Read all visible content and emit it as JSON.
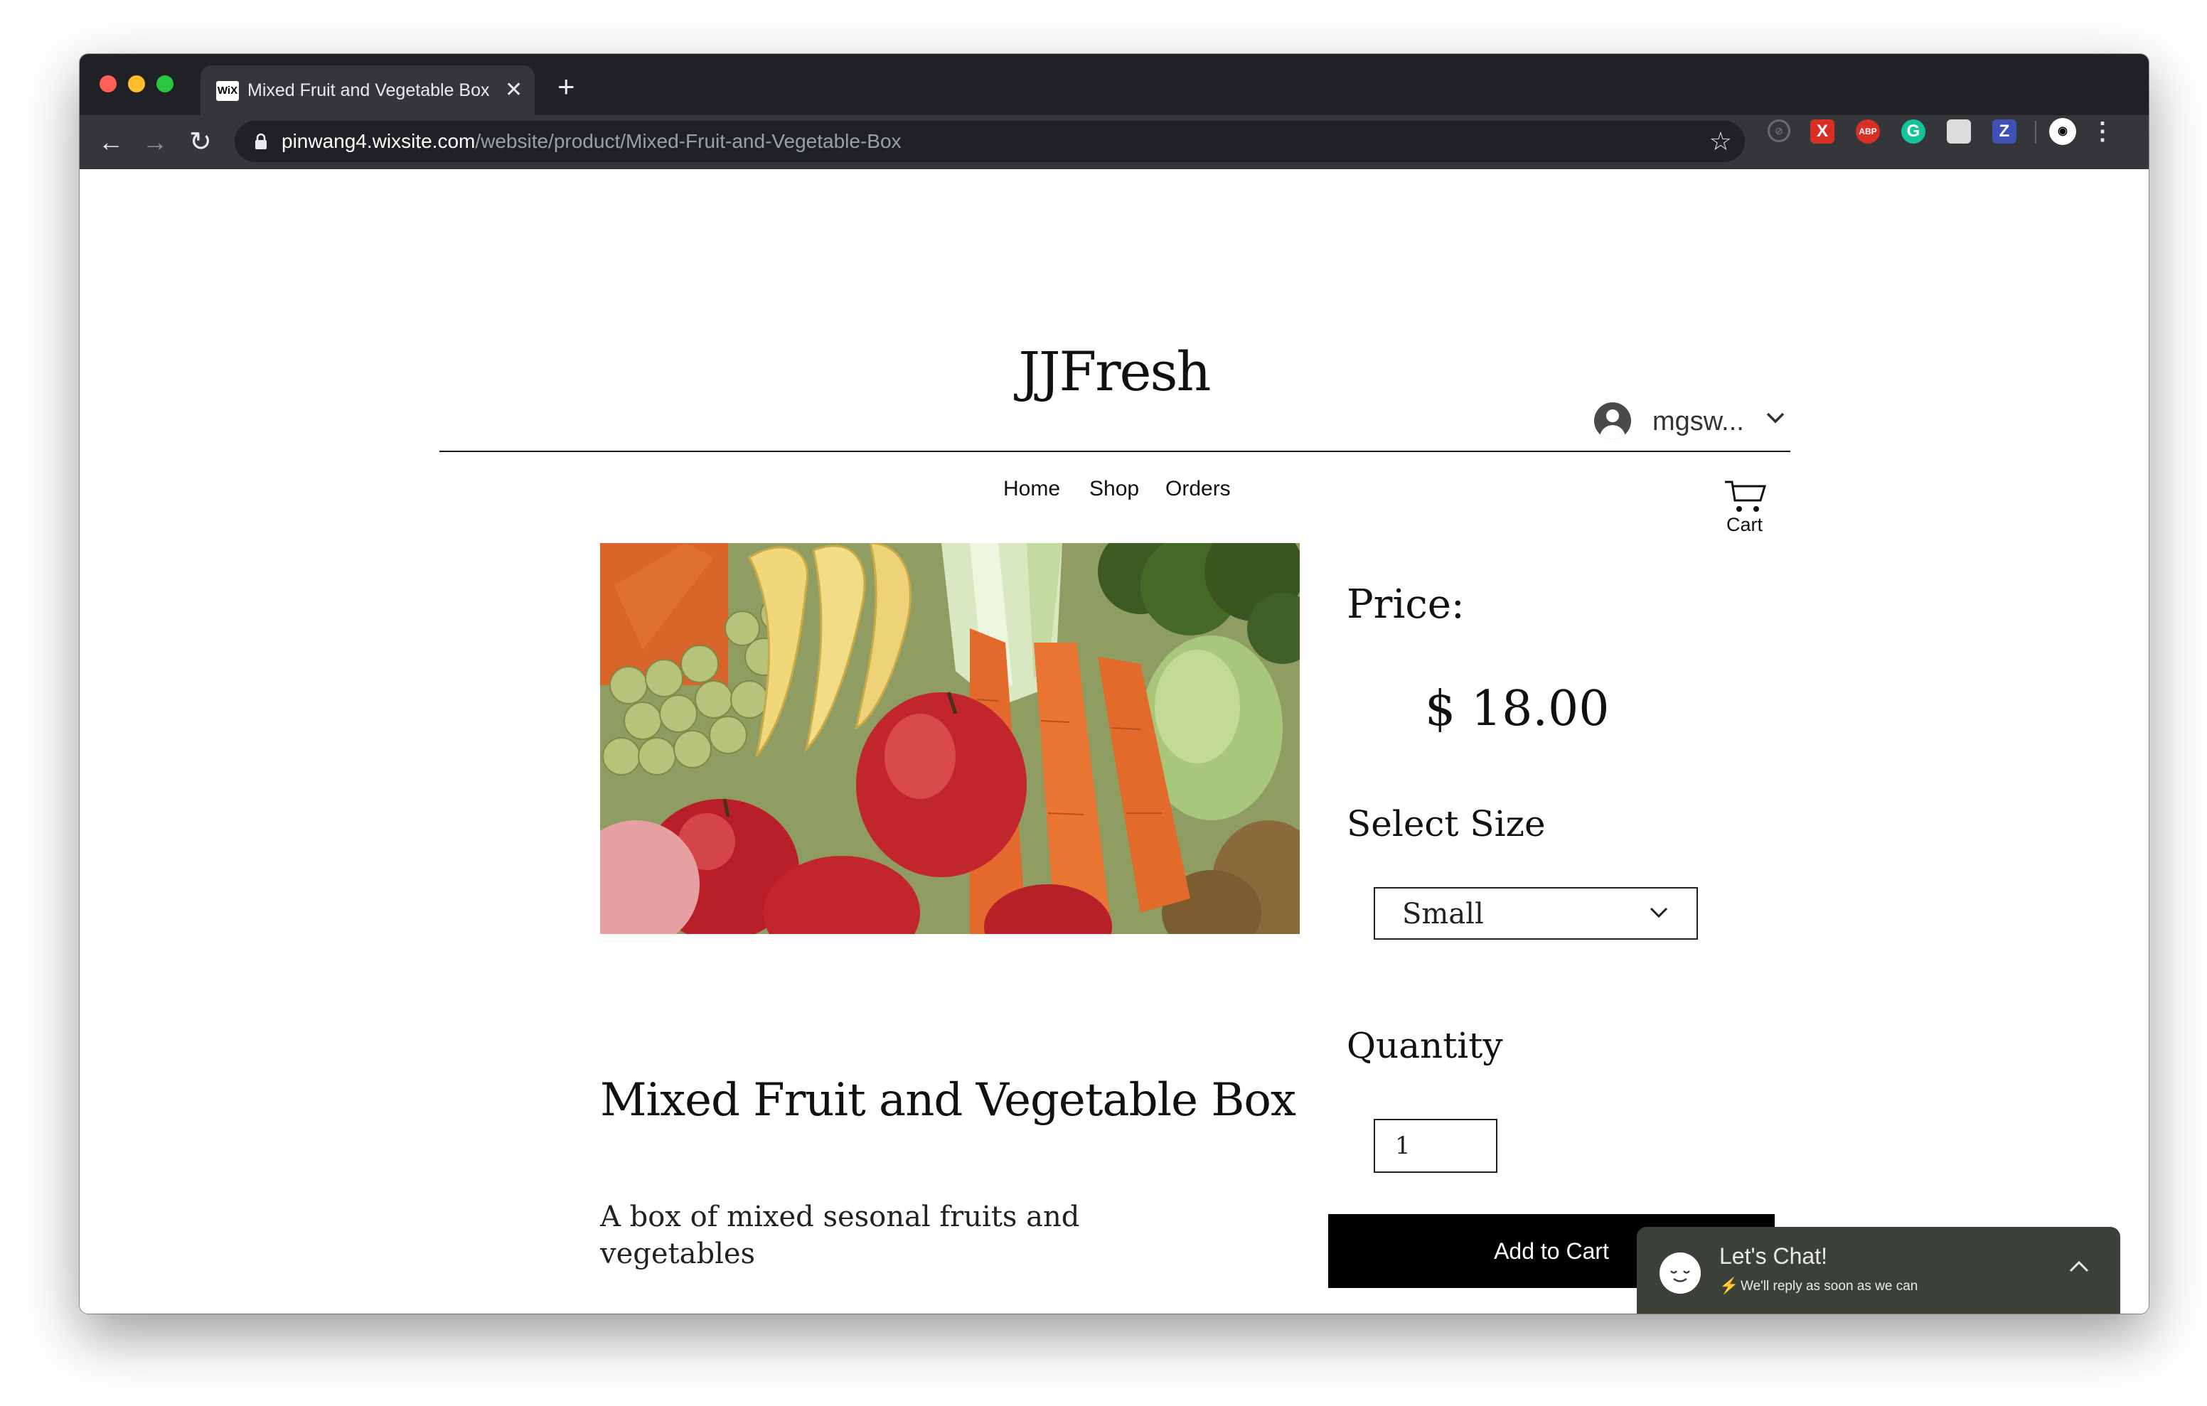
{
  "browser": {
    "tab_title": "Mixed Fruit and Vegetable Box",
    "favicon_text": "WiX",
    "url_host": "pinwang4.wixsite.com",
    "url_path": "/website/product/Mixed-Fruit-and-Vegetable-Box",
    "extensions": [
      "sync-icon",
      "x-extension-icon",
      "abp-icon",
      "grammarly-icon",
      "screenshot-extension-icon",
      "z-extension-icon",
      "profile-avatar"
    ]
  },
  "site": {
    "title": "JJFresh",
    "user_name": "mgsw...",
    "nav": [
      "Home",
      "Shop",
      "Orders"
    ],
    "cart_label": "Cart"
  },
  "product": {
    "price_label": "Price:",
    "price": "$ 18.00",
    "size_label": "Select Size",
    "size_value": "Small",
    "quantity_label": "Quantity",
    "quantity_value": "1",
    "add_to_cart": "Add to Cart",
    "title": "Mixed Fruit and Vegetable Box",
    "description": "A box of mixed sesonal fruits and vegetables"
  },
  "chat": {
    "title": "Let's Chat!",
    "subtitle": "We'll reply as soon as we can"
  },
  "colors": {
    "chrome_dark": "#202124",
    "chrome_toolbar": "#35363a",
    "chat_bg": "#3b4038",
    "button_bg": "#000000"
  }
}
